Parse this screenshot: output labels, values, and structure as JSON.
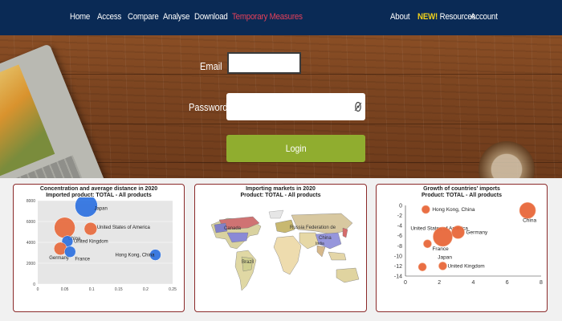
{
  "nav": {
    "items": [
      "Home",
      "Access",
      "Compare",
      "Analyse",
      "Download",
      "Temporary Measures",
      "About"
    ],
    "new_badge": "NEW!",
    "resources": "Resources",
    "account": "Account"
  },
  "login": {
    "email_label": "Email",
    "password_label": "Password",
    "email_value": "",
    "password_value": "",
    "login_button": "Login"
  },
  "colors": {
    "nav_bg": "#0a2a55",
    "highlight": "#e8405a",
    "new": "#f2d21a",
    "login": "#90ad2f",
    "bubble_orange": "#e8683a",
    "bubble_blue": "#2a6fe0",
    "panel_border": "#8b2a2a"
  },
  "panels": {
    "p1": {
      "title_line1": "Concentration and average distance in 2020",
      "title_line2": "Imported product: TOTAL - All products"
    },
    "p2": {
      "title_line1": "Importing markets in 2020",
      "title_line2": "Product: TOTAL - All products"
    },
    "p3": {
      "title_line1": "Growth of countries' imports",
      "title_line2": "Product: TOTAL - All products"
    }
  },
  "chart_data": [
    {
      "type": "scatter",
      "title": "Concentration and average distance in 2020",
      "subtitle": "Imported product: TOTAL - All products",
      "xlim": [
        0,
        0.25
      ],
      "ylim": [
        0,
        8000
      ],
      "xticks": [
        "0",
        "0.05",
        "0.1",
        "0.15",
        "0.2",
        "0.25"
      ],
      "yticks": [
        "0",
        "2000",
        "4000",
        "6000",
        "8000"
      ],
      "points": [
        {
          "label": "Japan",
          "x": 0.09,
          "y": 7500,
          "size": 14,
          "color": "#2a6fe0"
        },
        {
          "label": "United States of America",
          "x": 0.098,
          "y": 5300,
          "size": 8,
          "color": "#e8683a"
        },
        {
          "label": "China",
          "x": 0.05,
          "y": 5400,
          "size": 13,
          "color": "#e8683a"
        },
        {
          "label": "United Kingdom",
          "x": 0.055,
          "y": 4100,
          "size": 7,
          "color": "#2a6fe0"
        },
        {
          "label": "Germany",
          "x": 0.042,
          "y": 3400,
          "size": 8,
          "color": "#e8683a"
        },
        {
          "label": "France",
          "x": 0.06,
          "y": 3100,
          "size": 7,
          "color": "#2a6fe0"
        },
        {
          "label": "Hong Kong, China",
          "x": 0.218,
          "y": 2800,
          "size": 7,
          "color": "#2a6fe0"
        }
      ]
    },
    {
      "type": "map",
      "title": "Importing markets in 2020",
      "subtitle": "Product: TOTAL - All products",
      "labels": [
        "Canada",
        "Russia Federation de",
        "China",
        "Brazil",
        "India"
      ]
    },
    {
      "type": "scatter",
      "title": "Growth of countries' imports",
      "subtitle": "Product: TOTAL - All products",
      "xlim": [
        0,
        8
      ],
      "ylim": [
        -14,
        0
      ],
      "xticks": [
        "0",
        "2",
        "4",
        "6",
        "8"
      ],
      "yticks": [
        "0",
        "-2",
        "-4",
        "-6",
        "-8",
        "-10",
        "-12",
        "-14"
      ],
      "points": [
        {
          "label": "Hong Kong, China",
          "x": 1.2,
          "y": -0.8,
          "size": 5
        },
        {
          "label": "China",
          "x": 7.2,
          "y": -1.0,
          "size": 10
        },
        {
          "label": "United States of America",
          "x": 2.1,
          "y": -4.5,
          "size": 0
        },
        {
          "label": "Germany",
          "x": 3.1,
          "y": -5.3,
          "size": 8
        },
        {
          "label": "",
          "x": 2.2,
          "y": -6.2,
          "size": 12
        },
        {
          "label": "France",
          "x": 1.3,
          "y": -7.6,
          "size": 5
        },
        {
          "label": "Japan",
          "x": 2.0,
          "y": -10.3,
          "size": 0
        },
        {
          "label": "United Kingdom",
          "x": 2.2,
          "y": -12.0,
          "size": 5
        },
        {
          "label": "",
          "x": 1.0,
          "y": -12.2,
          "size": 5
        }
      ]
    }
  ]
}
